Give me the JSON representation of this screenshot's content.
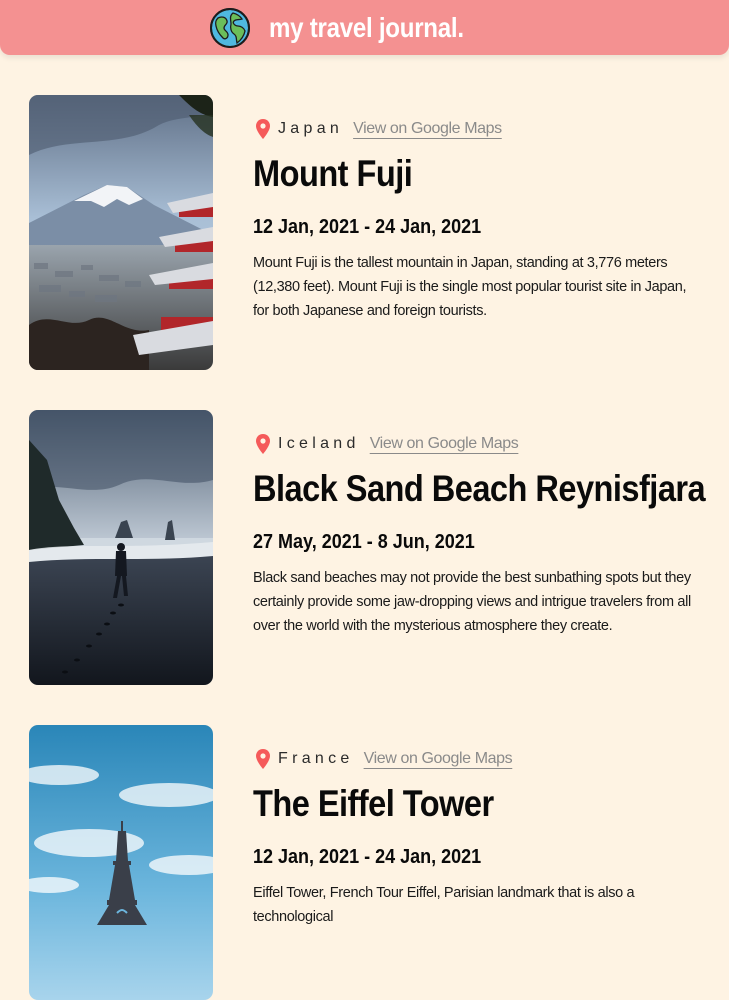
{
  "header": {
    "brand": "my travel journal.",
    "globe_icon": "globe-icon",
    "colors": {
      "background": "#F49191",
      "text": "#FFFFFF",
      "page": "#FEF3E3",
      "pin": "#F55A5A"
    }
  },
  "entries": [
    {
      "country": "Japan",
      "maps_label": "View on Google Maps",
      "title": "Mount Fuji",
      "dates": "12 Jan, 2021 - 24 Jan, 2021",
      "description": "Mount Fuji is the tallest mountain in Japan, standing at 3,776 meters (12,380 feet). Mount Fuji is the single most popular tourist site in Japan, for both Japanese and foreign tourists.",
      "image": "mount-fuji-photo"
    },
    {
      "country": "Iceland",
      "maps_label": "View on Google Maps",
      "title": "Black Sand Beach Reynisfjara",
      "dates": "27 May, 2021 - 8 Jun, 2021",
      "description": "Black sand beaches may not provide the best sunbathing spots but they certainly provide some jaw-dropping views and intrigue travelers from all over the world with the mysterious atmosphere they create.",
      "image": "black-sand-beach-photo"
    },
    {
      "country": "France",
      "maps_label": "View on Google Maps",
      "title": "The Eiffel Tower",
      "dates": "12 Jan, 2021 - 24 Jan, 2021",
      "description": "Eiffel Tower, French Tour Eiffel, Parisian landmark that is also a technological",
      "image": "eiffel-tower-photo"
    }
  ]
}
